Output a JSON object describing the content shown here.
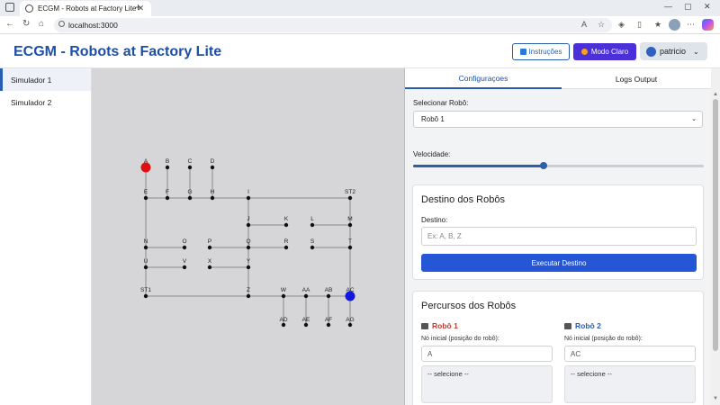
{
  "browser": {
    "tab_title": "ECGM - Robots at Factory Lite",
    "url": "localhost:3000"
  },
  "header": {
    "title": "ECGM - Robots at Factory Lite",
    "instructions_label": "Instruções",
    "mode_label": "Modo Claro",
    "user_label": "patricio"
  },
  "sidebar": {
    "items": [
      {
        "label": "Simulador 1",
        "active": true
      },
      {
        "label": "Simulador 2",
        "active": false
      }
    ]
  },
  "graph": {
    "nodes": [
      {
        "id": "A"
      },
      {
        "id": "B"
      },
      {
        "id": "C"
      },
      {
        "id": "D"
      },
      {
        "id": "E"
      },
      {
        "id": "F"
      },
      {
        "id": "G"
      },
      {
        "id": "H"
      },
      {
        "id": "I"
      },
      {
        "id": "ST2"
      },
      {
        "id": "J"
      },
      {
        "id": "K"
      },
      {
        "id": "L"
      },
      {
        "id": "M"
      },
      {
        "id": "N"
      },
      {
        "id": "O"
      },
      {
        "id": "P"
      },
      {
        "id": "Q"
      },
      {
        "id": "R"
      },
      {
        "id": "S"
      },
      {
        "id": "T"
      },
      {
        "id": "U"
      },
      {
        "id": "V"
      },
      {
        "id": "X"
      },
      {
        "id": "Y"
      },
      {
        "id": "ST1"
      },
      {
        "id": "Z"
      },
      {
        "id": "W"
      },
      {
        "id": "AA"
      },
      {
        "id": "AB"
      },
      {
        "id": "AC"
      },
      {
        "id": "AD"
      },
      {
        "id": "AE"
      },
      {
        "id": "AF"
      },
      {
        "id": "AG"
      }
    ],
    "edges": [
      [
        "A",
        "E"
      ],
      [
        "B",
        "F"
      ],
      [
        "C",
        "G"
      ],
      [
        "D",
        "H"
      ],
      [
        "E",
        "F"
      ],
      [
        "F",
        "G"
      ],
      [
        "G",
        "H"
      ],
      [
        "H",
        "I"
      ],
      [
        "I",
        "ST2"
      ],
      [
        "E",
        "N"
      ],
      [
        "N",
        "U"
      ],
      [
        "U",
        "ST1"
      ],
      [
        "ST2",
        "M"
      ],
      [
        "M",
        "T"
      ],
      [
        "T",
        "AC"
      ],
      [
        "I",
        "J"
      ],
      [
        "J",
        "Q"
      ],
      [
        "Q",
        "Y"
      ],
      [
        "Y",
        "Z"
      ],
      [
        "J",
        "K"
      ],
      [
        "L",
        "M"
      ],
      [
        "N",
        "O"
      ],
      [
        "P",
        "Q"
      ],
      [
        "Q",
        "R"
      ],
      [
        "S",
        "T"
      ],
      [
        "U",
        "V"
      ],
      [
        "X",
        "Y"
      ],
      [
        "ST1",
        "Z"
      ],
      [
        "Z",
        "W"
      ],
      [
        "W",
        "AA"
      ],
      [
        "AA",
        "AB"
      ],
      [
        "AB",
        "AC"
      ],
      [
        "W",
        "AD"
      ],
      [
        "AA",
        "AE"
      ],
      [
        "AB",
        "AF"
      ],
      [
        "AC",
        "AG"
      ]
    ],
    "robots": [
      {
        "name": "Robô 1",
        "at": "A",
        "color": "#e01010"
      },
      {
        "name": "Robô 2",
        "at": "AC",
        "color": "#1018e0"
      }
    ]
  },
  "panel": {
    "tabs": [
      "Configuraçoes",
      "Logs Output"
    ],
    "select_robot_label": "Selecionar Robô:",
    "selected_robot": "Robô 1",
    "speed_label": "Velocidade:",
    "speed_fraction": 0.45,
    "destination_card": {
      "title": "Destino dos Robôs",
      "field_label": "Destino:",
      "placeholder": "Ex: A, B, Z",
      "button_label": "Executar Destino"
    },
    "routes_card": {
      "title": "Percursos dos Robôs",
      "robots": [
        {
          "name": "Robô 1",
          "color": "#c0392b",
          "start_label": "Nó inicial (posição do robô):",
          "start_value": "A",
          "select_placeholder": "-- selecione --"
        },
        {
          "name": "Robô 2",
          "color": "#2a5db0",
          "start_label": "Nó inicial (posição do robô):",
          "start_value": "AC",
          "select_placeholder": "-- selecione --"
        }
      ]
    }
  }
}
